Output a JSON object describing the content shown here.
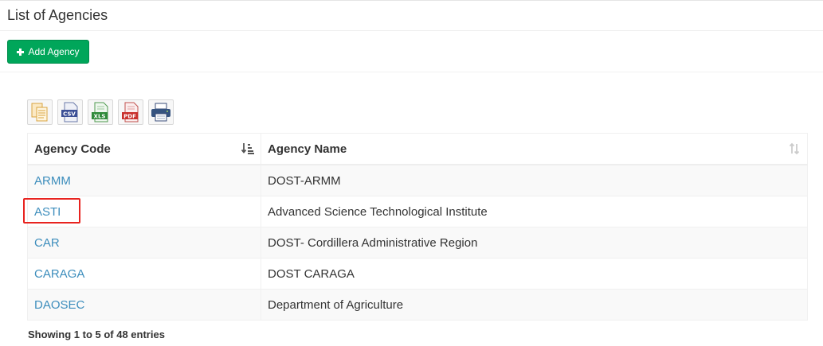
{
  "header": {
    "title": "List of Agencies"
  },
  "actions": {
    "add_label": "Add Agency"
  },
  "export_buttons": [
    {
      "name": "copy-icon"
    },
    {
      "name": "csv-icon",
      "label": "CSV"
    },
    {
      "name": "xls-icon",
      "label": "XLS"
    },
    {
      "name": "pdf-icon",
      "label": "PDF"
    },
    {
      "name": "print-icon"
    }
  ],
  "table": {
    "columns": [
      "Agency Code",
      "Agency Name"
    ],
    "sort": {
      "column": "Agency Code",
      "direction": "descending-active"
    },
    "rows": [
      {
        "code": "ARMM",
        "name": "DOST-ARMM"
      },
      {
        "code": "ASTI",
        "name": "Advanced Science Technological Institute"
      },
      {
        "code": "CAR",
        "name": "DOST- Cordillera Administrative Region"
      },
      {
        "code": "CARAGA",
        "name": "DOST CARAGA"
      },
      {
        "code": "DAOSEC",
        "name": "Department of Agriculture"
      }
    ]
  },
  "pagination_info": "Showing 1 to 5 of 48 entries",
  "colors": {
    "primary_button": "#00a65a",
    "link": "#3c8dbc",
    "highlight": "#e8231f"
  }
}
